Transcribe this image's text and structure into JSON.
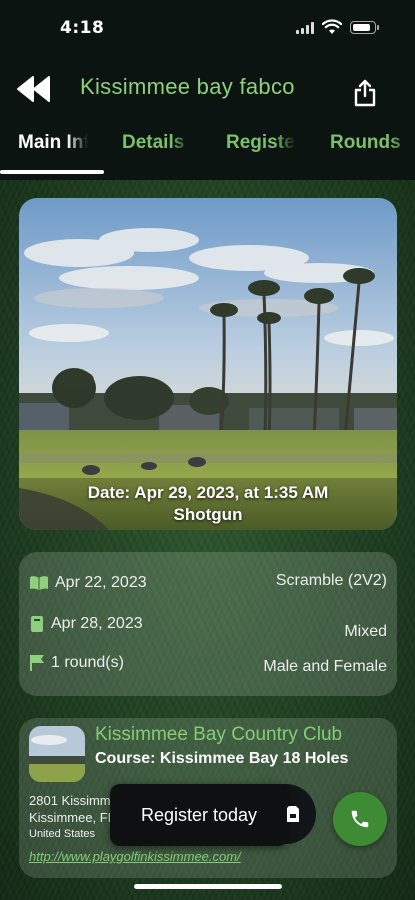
{
  "status_bar": {
    "time": "4:18"
  },
  "header": {
    "title": "Kissimmee bay fabco"
  },
  "tabs": [
    {
      "label": "Main Info"
    },
    {
      "label": "Details"
    },
    {
      "label": "Register"
    },
    {
      "label": "Rounds"
    }
  ],
  "hero": {
    "date_line": "Date: Apr 29, 2023, at 1:35 AM",
    "format_line": "Shotgun"
  },
  "info": {
    "registration_open": "Apr 22, 2023",
    "registration_close": "Apr 28, 2023",
    "rounds": "1 round(s)",
    "game_type": "Scramble (2V2)",
    "division": "Mixed",
    "gender": "Male and Female"
  },
  "club": {
    "name": "Kissimmee Bay Country Club",
    "course": "Course: Kissimmee Bay 18 Holes",
    "address_line1": "2801 Kissimmee Bay Blvd",
    "address_line2": "Kissimmee, FL 34744",
    "address_line3": "United States",
    "url": "http://www.playgolfinkissimmee.com/"
  },
  "register": {
    "label": "Register today"
  },
  "icons": {
    "back": "double-chevron-left-icon",
    "share": "share-icon",
    "open_date": "book-open-icon",
    "close_date": "book-closed-icon",
    "rounds": "flag-icon",
    "phone": "phone-icon"
  },
  "colors": {
    "accent_green": "#8fd07e",
    "fab_green": "#3f8a35"
  }
}
